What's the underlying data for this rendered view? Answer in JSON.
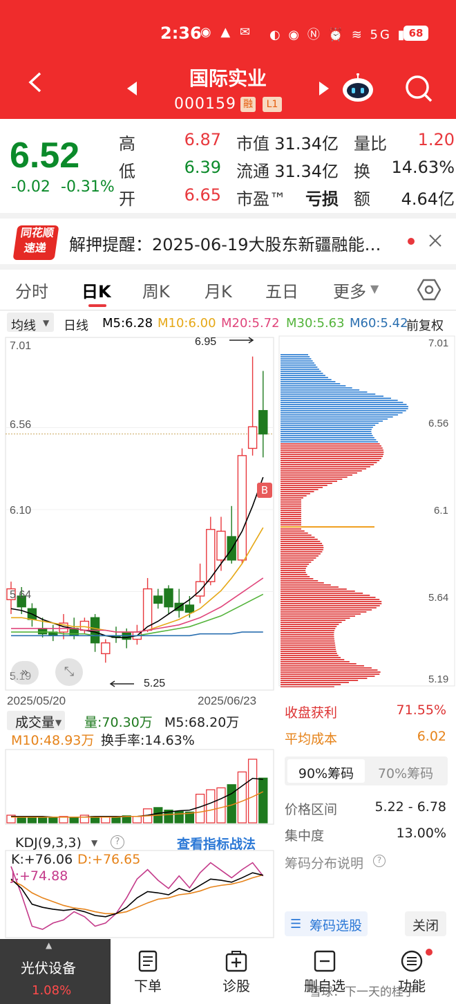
{
  "status_bar": {
    "time": "2:36",
    "battery": "68",
    "signal": "5G"
  },
  "header": {
    "title": "国际实业",
    "code": "000159",
    "tag_rong": "融",
    "tag_level": "L1"
  },
  "quote": {
    "price": "6.52",
    "change": "-0.02",
    "change_pct": "-0.31%",
    "high_label": "高",
    "high": "6.87",
    "low_label": "低",
    "low": "6.39",
    "open_label": "开",
    "open": "6.65",
    "mktcap_label": "市值",
    "mktcap": "31.34亿",
    "float_label": "流通",
    "float": "31.34亿",
    "pe_label": "市盈™",
    "pe": "亏损",
    "vol_ratio_label": "量比",
    "vol_ratio": "1.20",
    "turnover_label": "换",
    "turnover": "14.63%",
    "amount_label": "额",
    "amount": "4.64亿"
  },
  "news": {
    "logo_top": "同花顺",
    "logo_bottom": "速递",
    "text": "解押提醒：2025-06-19大股东新疆融能…"
  },
  "tabs": [
    "分时",
    "日K",
    "周K",
    "月K",
    "五日",
    "更多"
  ],
  "ma_bar": {
    "selector": "均线",
    "period": "日线",
    "m5": "M5:6.28",
    "m10": "M10:6.00",
    "m20": "M20:5.72",
    "m30": "M30:5.63",
    "m60": "M60:5.42",
    "adjust": "前复权"
  },
  "colors": {
    "up": "#e8383d",
    "down": "#1f7a1f",
    "m5": "#000000",
    "m10": "#e6a817",
    "m20": "#e0457b",
    "m30": "#53b33a",
    "m60": "#2a6fb0",
    "brand": "#ef2c2c"
  },
  "chart_data": [
    {
      "type": "candlestick",
      "title": "日K",
      "y_ticks": [
        "7.01",
        "6.56",
        "6.10",
        "5.64",
        "5.19"
      ],
      "x_start": "2025/05/20",
      "x_end": "2025/06/23",
      "annotations": {
        "high_mark": "6.95",
        "low_mark": "5.25",
        "buy_flag": "B"
      },
      "candles": [
        {
          "o": 5.6,
          "c": 5.66,
          "h": 5.7,
          "l": 5.52,
          "up": true
        },
        {
          "o": 5.62,
          "c": 5.56,
          "h": 5.67,
          "l": 5.52,
          "up": false
        },
        {
          "o": 5.55,
          "c": 5.49,
          "h": 5.58,
          "l": 5.45,
          "up": false
        },
        {
          "o": 5.44,
          "c": 5.41,
          "h": 5.5,
          "l": 5.39,
          "up": false
        },
        {
          "o": 5.4,
          "c": 5.42,
          "h": 5.46,
          "l": 5.37,
          "up": false
        },
        {
          "o": 5.42,
          "c": 5.47,
          "h": 5.52,
          "l": 5.38,
          "up": true
        },
        {
          "o": 5.44,
          "c": 5.4,
          "h": 5.5,
          "l": 5.38,
          "up": false
        },
        {
          "o": 5.43,
          "c": 5.48,
          "h": 5.5,
          "l": 5.41,
          "up": true
        },
        {
          "o": 5.5,
          "c": 5.36,
          "h": 5.52,
          "l": 5.31,
          "up": false
        },
        {
          "o": 5.3,
          "c": 5.36,
          "h": 5.38,
          "l": 5.25,
          "up": true
        },
        {
          "o": 5.4,
          "c": 5.39,
          "h": 5.45,
          "l": 5.36,
          "up": false
        },
        {
          "o": 5.38,
          "c": 5.42,
          "h": 5.44,
          "l": 5.33,
          "up": false
        },
        {
          "o": 5.38,
          "c": 5.42,
          "h": 5.46,
          "l": 5.35,
          "up": true
        },
        {
          "o": 5.43,
          "c": 5.66,
          "h": 5.72,
          "l": 5.42,
          "up": true
        },
        {
          "o": 5.62,
          "c": 5.58,
          "h": 5.66,
          "l": 5.55,
          "up": false
        },
        {
          "o": 5.66,
          "c": 5.56,
          "h": 5.68,
          "l": 5.52,
          "up": false
        },
        {
          "o": 5.58,
          "c": 5.54,
          "h": 5.66,
          "l": 5.5,
          "up": false
        },
        {
          "o": 5.57,
          "c": 5.53,
          "h": 5.62,
          "l": 5.5,
          "up": false
        },
        {
          "o": 5.62,
          "c": 5.7,
          "h": 5.8,
          "l": 5.58,
          "up": true
        },
        {
          "o": 5.7,
          "c": 5.99,
          "h": 6.06,
          "l": 5.68,
          "up": true
        },
        {
          "o": 5.82,
          "c": 5.98,
          "h": 6.06,
          "l": 5.76,
          "up": true
        },
        {
          "o": 5.95,
          "c": 5.82,
          "h": 6.12,
          "l": 5.8,
          "up": false
        },
        {
          "o": 5.82,
          "c": 6.4,
          "h": 6.44,
          "l": 5.8,
          "up": true
        },
        {
          "o": 6.44,
          "c": 6.56,
          "h": 6.95,
          "l": 6.4,
          "up": true
        },
        {
          "o": 6.65,
          "c": 6.52,
          "h": 6.87,
          "l": 6.39,
          "up": false
        }
      ],
      "ma": {
        "m5": [
          5.55,
          5.54,
          5.52,
          5.49,
          5.47,
          5.45,
          5.44,
          5.43,
          5.42,
          5.4,
          5.39,
          5.39,
          5.4,
          5.45,
          5.48,
          5.52,
          5.56,
          5.6,
          5.65,
          5.72,
          5.8,
          5.88,
          5.98,
          6.12,
          6.28
        ],
        "m10": [
          5.5,
          5.5,
          5.49,
          5.48,
          5.47,
          5.46,
          5.45,
          5.45,
          5.44,
          5.43,
          5.42,
          5.42,
          5.42,
          5.43,
          5.45,
          5.47,
          5.49,
          5.52,
          5.55,
          5.6,
          5.65,
          5.72,
          5.8,
          5.9,
          6.0
        ],
        "m20": [
          5.44,
          5.44,
          5.44,
          5.44,
          5.44,
          5.44,
          5.44,
          5.43,
          5.43,
          5.43,
          5.42,
          5.42,
          5.42,
          5.43,
          5.44,
          5.45,
          5.46,
          5.48,
          5.5,
          5.53,
          5.56,
          5.6,
          5.64,
          5.68,
          5.72
        ],
        "m30": [
          5.42,
          5.42,
          5.42,
          5.42,
          5.42,
          5.41,
          5.41,
          5.41,
          5.4,
          5.4,
          5.4,
          5.4,
          5.4,
          5.41,
          5.42,
          5.43,
          5.44,
          5.45,
          5.47,
          5.49,
          5.51,
          5.54,
          5.57,
          5.6,
          5.63
        ],
        "m60": [
          5.4,
          5.4,
          5.4,
          5.4,
          5.4,
          5.4,
          5.4,
          5.4,
          5.4,
          5.4,
          5.4,
          5.4,
          5.4,
          5.4,
          5.4,
          5.4,
          5.4,
          5.4,
          5.41,
          5.41,
          5.41,
          5.41,
          5.42,
          5.42,
          5.42
        ]
      }
    },
    {
      "type": "bar",
      "title": "成交量",
      "labels": {
        "vol": "量:70.30万",
        "m5": "M5:68.20万",
        "m10": "M10:48.93万",
        "turnover": "换手率:14.63%"
      },
      "values": [
        12,
        10,
        9,
        8,
        9,
        10,
        8,
        12,
        10,
        9,
        10,
        11,
        10,
        22,
        24,
        20,
        18,
        17,
        45,
        52,
        55,
        60,
        80,
        100,
        70.3
      ],
      "ma5": [
        10,
        10,
        10,
        10,
        9,
        9,
        9,
        9,
        10,
        10,
        10,
        10,
        10,
        12,
        15,
        17,
        19,
        20,
        25,
        31,
        38,
        46,
        58,
        70,
        68.2
      ],
      "ma10": [
        9,
        9,
        9,
        9,
        9,
        9,
        9,
        9,
        9,
        9,
        9,
        10,
        10,
        11,
        12,
        13,
        14,
        15,
        17,
        20,
        24,
        28,
        34,
        41,
        48.93
      ]
    },
    {
      "type": "line",
      "title": "KDJ(9,3,3)",
      "labels": {
        "k": "K:+76.06",
        "d": "D:+76.65",
        "j": "J:+74.88"
      },
      "K": [
        70,
        55,
        30,
        25,
        22,
        20,
        22,
        18,
        12,
        10,
        15,
        25,
        40,
        50,
        48,
        45,
        55,
        50,
        60,
        70,
        68,
        65,
        72,
        80,
        76
      ],
      "D": [
        68,
        60,
        48,
        40,
        34,
        28,
        24,
        22,
        18,
        15,
        15,
        18,
        25,
        32,
        38,
        40,
        45,
        47,
        51,
        57,
        60,
        62,
        66,
        72,
        76.65
      ],
      "J": [
        90,
        45,
        -5,
        -10,
        0,
        5,
        18,
        10,
        -5,
        0,
        15,
        40,
        70,
        85,
        68,
        55,
        75,
        56,
        80,
        96,
        84,
        72,
        85,
        96,
        74.88
      ]
    },
    {
      "type": "bar",
      "title": "筹码分布",
      "y_ticks": [
        "7.01",
        "6.56",
        "6.1",
        "5.64",
        "5.19"
      ]
    }
  ],
  "chip_panel": {
    "profit_label": "收盘获利",
    "profit": "71.55%",
    "avg_cost_label": "平均成本",
    "avg_cost": "6.02",
    "tab_90": "90%筹码",
    "tab_70": "70%筹码",
    "range_label": "价格区间",
    "range": "5.22 - 6.78",
    "concentration_label": "集中度",
    "concentration": "13.00%",
    "help_label": "筹码分布说明",
    "select_btn": "筹码选股",
    "close_btn": "关闭"
  },
  "indicator_link": "查看指标战法",
  "nav": {
    "sector_name": "光伏设备",
    "sector_pct": "1.08%",
    "items": [
      "下单",
      "诊股",
      "删自选",
      "功能"
    ],
    "watermark": "雪球：下一天的桂乎"
  }
}
